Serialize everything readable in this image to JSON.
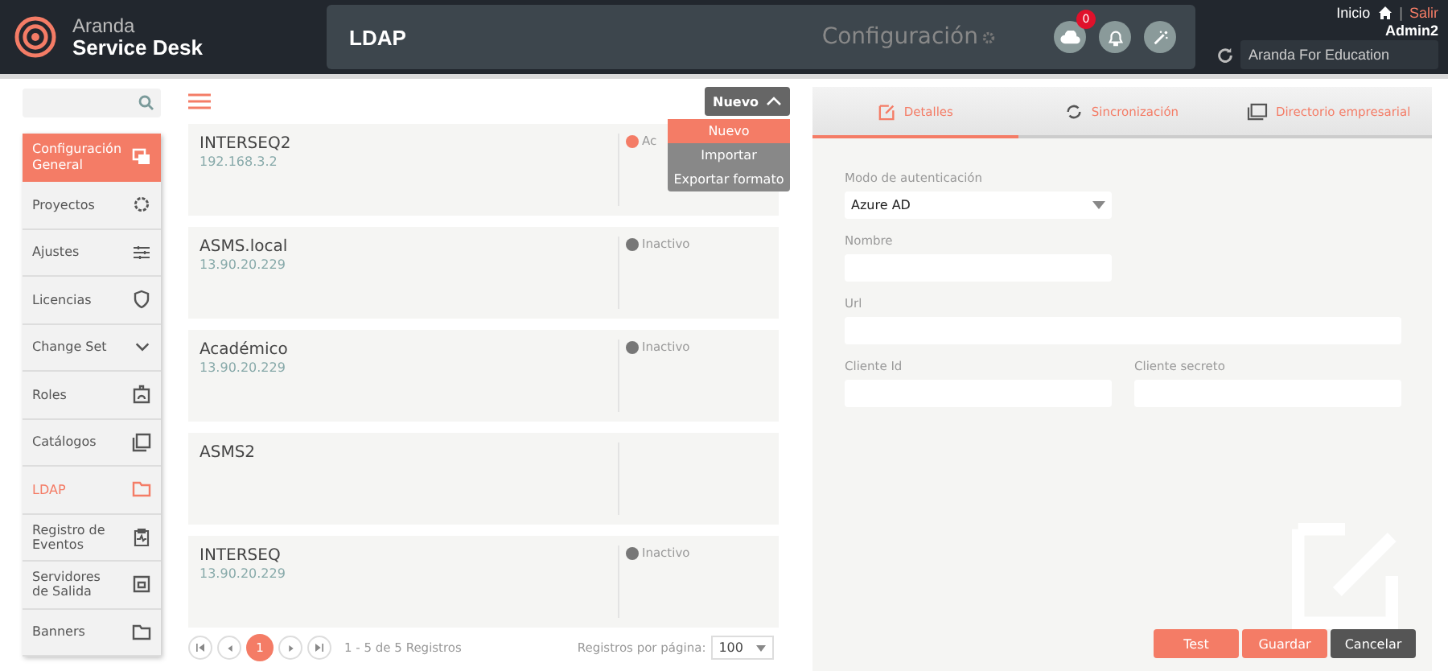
{
  "header": {
    "brand_top": "Aranda",
    "brand_bottom": "Service Desk",
    "breadcrumb": "LDAP",
    "section": "Configuración",
    "cloud_badge": "0",
    "home_link": "Inicio",
    "separator": "|",
    "logout_link": "Salir",
    "user": "Admin2",
    "project": "Aranda For Education"
  },
  "sidebar": {
    "header": "Configuración General",
    "items": [
      {
        "label": "Proyectos",
        "selected": false,
        "kind": "link"
      },
      {
        "label": "Ajustes",
        "selected": false,
        "kind": "link"
      },
      {
        "label": "Licencias",
        "selected": false,
        "kind": "link"
      },
      {
        "label": "Change Set",
        "selected": false,
        "kind": "group"
      },
      {
        "label": "Roles",
        "selected": false,
        "kind": "link"
      },
      {
        "label": "Catálogos",
        "selected": false,
        "kind": "link"
      },
      {
        "label": "LDAP",
        "selected": true,
        "kind": "link"
      },
      {
        "label": "Registro de Eventos",
        "selected": false,
        "kind": "link"
      },
      {
        "label": "Servidores de Salida",
        "selected": false,
        "kind": "link"
      },
      {
        "label": "Banners",
        "selected": false,
        "kind": "link"
      }
    ]
  },
  "list": {
    "new_button": "Nuevo",
    "menu": [
      {
        "label": "Nuevo",
        "selected": true
      },
      {
        "label": "Importar",
        "selected": false
      },
      {
        "label": "Exportar formato",
        "selected": false
      }
    ],
    "cards": [
      {
        "name": "INTERSEQ2",
        "address": "192.168.3.2",
        "status": "Ac",
        "color": "#f47c66"
      },
      {
        "name": "ASMS.local",
        "address": "13.90.20.229",
        "status": "Inactivo",
        "color": "#777777"
      },
      {
        "name": "Académico",
        "address": "13.90.20.229",
        "status": "Inactivo",
        "color": "#777777"
      },
      {
        "name": "ASMS2"
      },
      {
        "name": "INTERSEQ",
        "address": "13.90.20.229",
        "status": "Inactivo",
        "color": "#777777"
      }
    ],
    "pagination": {
      "current": "1",
      "summary": "1 - 5 de 5 Registros",
      "per_page_label": "Registros por página:",
      "per_page": "100"
    }
  },
  "detail": {
    "tabs": [
      {
        "label": "Detalles",
        "selected": true
      },
      {
        "label": "Sincronización",
        "selected": false
      },
      {
        "label": "Directorio empresarial",
        "selected": false
      }
    ],
    "auth_label": "Modo de autenticación",
    "auth_value": "Azure AD",
    "fields": [
      {
        "label": "Nombre"
      },
      {
        "label": "Url"
      },
      {
        "label": "Cliente Id"
      },
      {
        "label": "Cliente secreto"
      }
    ],
    "buttons": [
      {
        "label": "Test",
        "kind": "primary"
      },
      {
        "label": "Guardar",
        "kind": "primary"
      },
      {
        "label": "Cancelar",
        "kind": "dark"
      }
    ]
  }
}
